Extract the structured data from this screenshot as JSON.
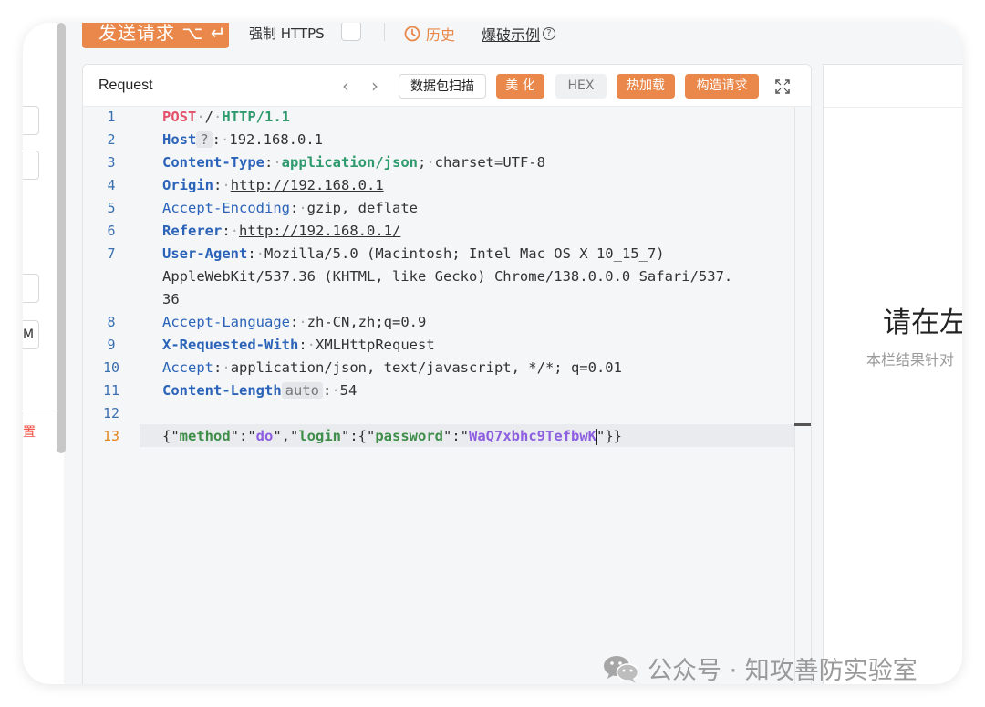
{
  "toolbar": {
    "send_label": "发送请求 ⌥ ↵",
    "force_https_label": "强制 HTTPS",
    "history_label": "历史",
    "example_label": "爆破示例"
  },
  "left_panel": {
    "partial_text_m": "M",
    "partial_text_red": "置"
  },
  "request_panel": {
    "title": "Request",
    "nav_prev": "‹",
    "nav_next": "›",
    "buttons": {
      "scan": "数据包扫描",
      "beautify": "美 化",
      "hex": "HEX",
      "hot_load": "热加载",
      "construct": "构造请求"
    },
    "line_numbers": [
      "1",
      "2",
      "3",
      "4",
      "5",
      "6",
      "7",
      "",
      "",
      "8",
      "9",
      "10",
      "11",
      "12",
      "13"
    ],
    "lines": {
      "l1": {
        "method": "POST",
        "path": "/",
        "proto": "HTTP/1.1"
      },
      "l2": {
        "name": "Host",
        "badge": "?",
        "value": "192.168.0.1"
      },
      "l3": {
        "name": "Content-Type",
        "value_type": "application/json",
        "value_rest": "charset=UTF-8"
      },
      "l4": {
        "name": "Origin",
        "value": "http://192.168.0.1"
      },
      "l5": {
        "name": "Accept-Encoding",
        "value": "gzip, deflate"
      },
      "l6": {
        "name": "Referer",
        "value": "http://192.168.0.1/"
      },
      "l7": {
        "name": "User-Agent",
        "value_a": "Mozilla/5.0 (Macintosh; Intel Mac OS X 10_15_7)",
        "value_b": "AppleWebKit/537.36 (KHTML, like Gecko) Chrome/138.0.0.0 Safari/537.",
        "value_c": "36"
      },
      "l8": {
        "name": "Accept-Language",
        "value": "zh-CN,zh;q=0.9"
      },
      "l9": {
        "name": "X-Requested-With",
        "value": "XMLHttpRequest"
      },
      "l10": {
        "name": "Accept",
        "value": "application/json, text/javascript, */*; q=0.01"
      },
      "l11": {
        "name": "Content-Length",
        "badge": "auto",
        "value": "54"
      },
      "l13": {
        "key1": "method",
        "val1": "do",
        "key2": "login",
        "key3": "password",
        "val3": "WaQ7xbhc9TefbwK"
      }
    }
  },
  "response_panel": {
    "big_text": "请在左",
    "small_text": "本栏结果针对"
  },
  "watermark": {
    "text": "公众号 · 知攻善防实验室"
  }
}
